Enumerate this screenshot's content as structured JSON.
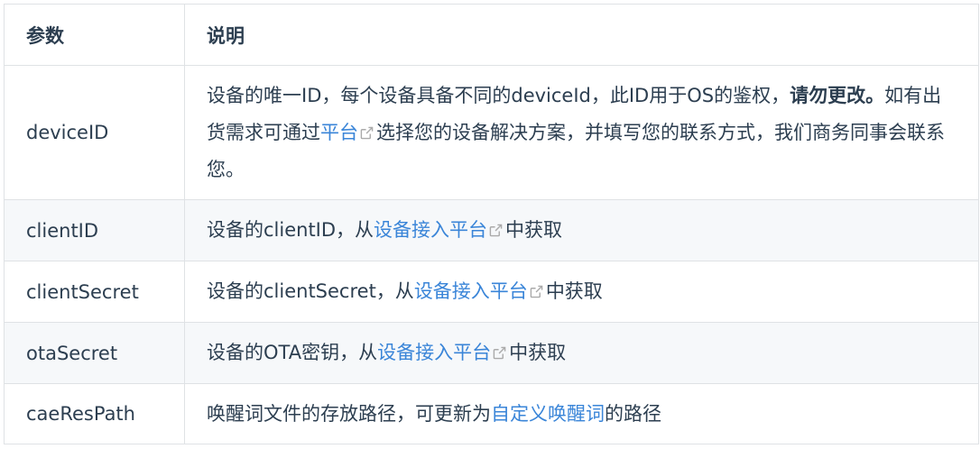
{
  "header": {
    "param": "参数",
    "desc": "说明"
  },
  "rows": [
    {
      "param": "deviceID",
      "desc_a": "设备的唯一ID，每个设备具备不同的deviceId，此ID用于OS的鉴权，",
      "desc_bold": "请勿更改。",
      "desc_b": "如有出货需求可通过",
      "link": "平台",
      "desc_c": "选择您的设备解决方案，并填写您的联系方式，我们商务同事会联系您。"
    },
    {
      "param": "clientID",
      "desc_a": "设备的clientID，从",
      "link": "设备接入平台",
      "desc_b": "中获取"
    },
    {
      "param": "clientSecret",
      "desc_a": "设备的clientSecret，从",
      "link": "设备接入平台",
      "desc_b": "中获取"
    },
    {
      "param": "otaSecret",
      "desc_a": "设备的OTA密钥，从",
      "link": "设备接入平台",
      "desc_b": "中获取"
    },
    {
      "param": "caeResPath",
      "desc_a": "唤醒词文件的存放路径，可更新为",
      "link": "自定义唤醒词",
      "desc_b": "的路径"
    }
  ],
  "icons": {
    "external": "external-link-icon"
  },
  "colors": {
    "link": "#3a85d8",
    "text": "#2c3e50",
    "border": "#dfe2e5",
    "stripe": "#f6f8fa"
  }
}
